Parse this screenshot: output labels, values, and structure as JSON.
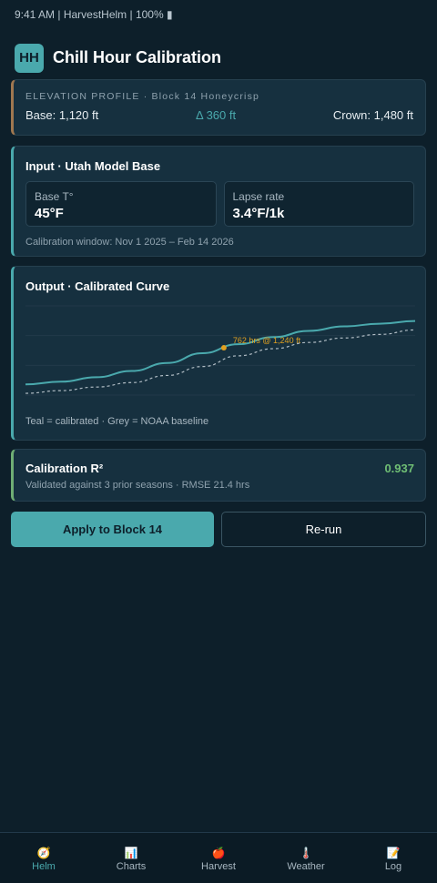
{
  "status_bar": {
    "text": "9:41 AM | HarvestHelm | 100% ▮"
  },
  "header": {
    "logo": "HH",
    "title": "Chill Hour Calibration"
  },
  "elevation": {
    "label": "ELEVATION PROFILE · Block 14 Honeycrisp",
    "base": "Base: 1,120 ft",
    "delta": "Δ 360 ft",
    "crown": "Crown: 1,480 ft"
  },
  "input": {
    "title": "Input · Utah Model Base",
    "base_temp_label": "Base T°",
    "base_temp_value": "45°F",
    "lapse_label": "Lapse rate",
    "lapse_value": "3.4°F/1k",
    "window": "Calibration window: Nov 1 2025 – Feb 14 2026"
  },
  "output": {
    "title": "Output · Calibrated Curve",
    "annotation": "762 hrs @ 1,240 ft",
    "legend": "Teal = calibrated · Grey = NOAA baseline"
  },
  "chart_data": {
    "type": "line",
    "series": [
      {
        "name": "calibrated",
        "color": "#4aa9ad",
        "values": [
          0.12,
          0.15,
          0.2,
          0.27,
          0.36,
          0.47,
          0.57,
          0.65,
          0.72,
          0.77,
          0.8,
          0.83
        ]
      },
      {
        "name": "NOAA baseline",
        "color": "#b0bcc4",
        "values": [
          0.02,
          0.05,
          0.09,
          0.14,
          0.22,
          0.32,
          0.44,
          0.52,
          0.59,
          0.64,
          0.68,
          0.73
        ]
      }
    ],
    "marker": {
      "series": 0,
      "index": 5.6,
      "label": "762 hrs @ 1,240 ft",
      "color": "#e0a020"
    },
    "grid": true
  },
  "r2": {
    "title": "Calibration R²",
    "value": "0.937",
    "sub": "Validated against 3 prior seasons · RMSE 21.4 hrs"
  },
  "actions": {
    "apply": "Apply to Block 14",
    "rerun": "Re-run"
  },
  "nav": [
    {
      "icon": "🧭",
      "label": "Helm",
      "active": true
    },
    {
      "icon": "📊",
      "label": "Charts",
      "active": false
    },
    {
      "icon": "🍎",
      "label": "Harvest",
      "active": false
    },
    {
      "icon": "🌡️",
      "label": "Weather",
      "active": false
    },
    {
      "icon": "📝",
      "label": "Log",
      "active": false
    }
  ],
  "colors": {
    "accent": "#4aa9ad",
    "background": "#0d1f2a",
    "card": "#16303f",
    "success": "#6fbe74",
    "marker": "#e0a020"
  }
}
